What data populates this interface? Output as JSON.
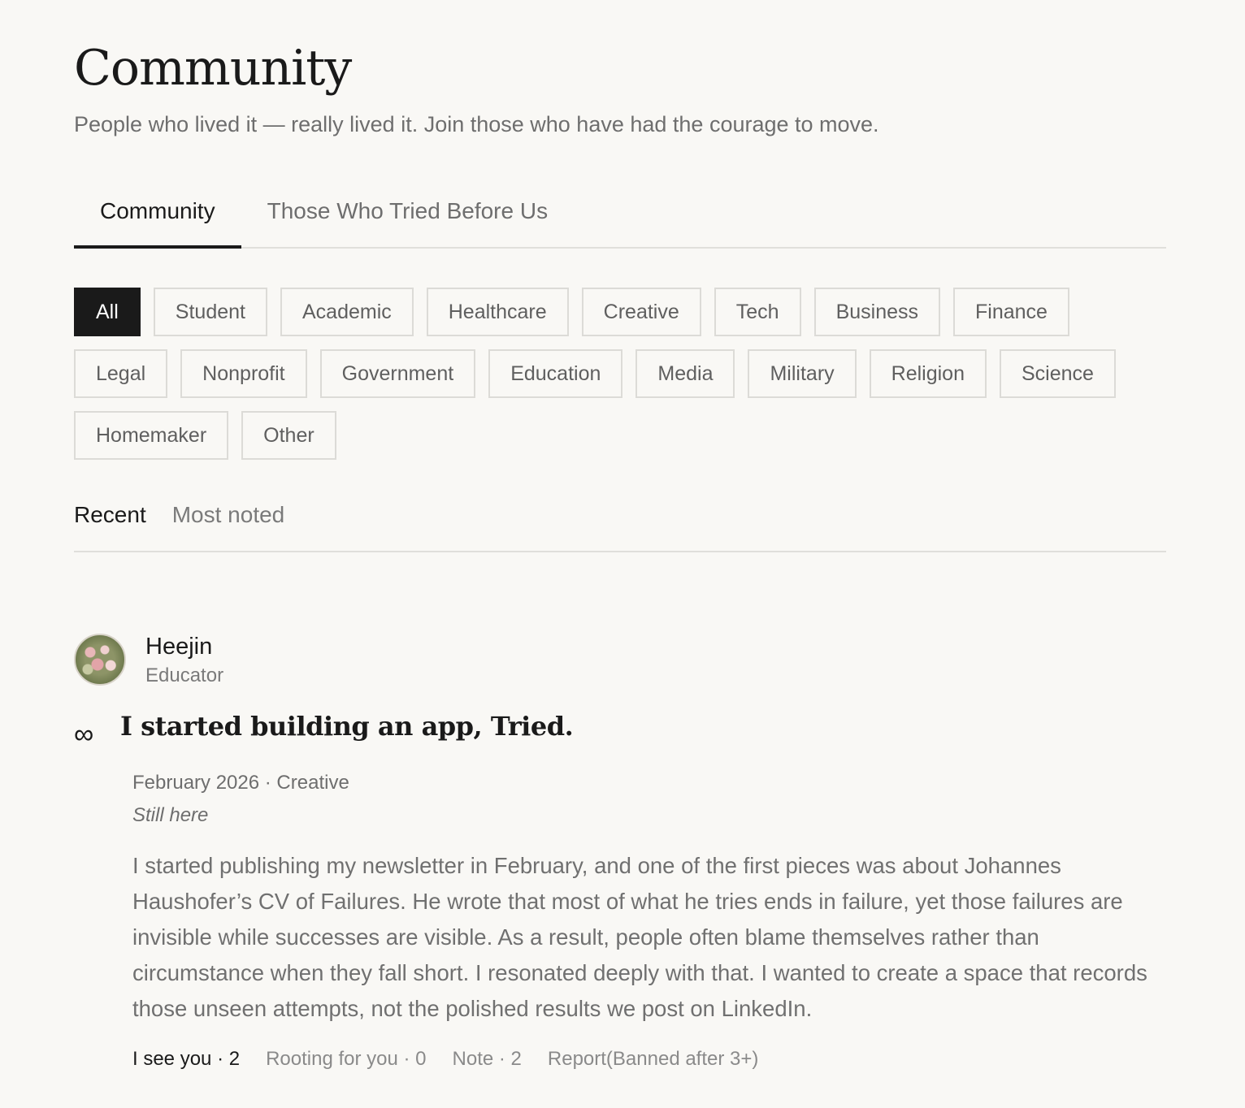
{
  "page": {
    "title": "Community",
    "subtitle": "People who lived it — really lived it. Join those who have had the courage to move."
  },
  "main_tabs": [
    {
      "label": "Community",
      "active": true
    },
    {
      "label": "Those Who Tried Before Us",
      "active": false
    }
  ],
  "categories": [
    {
      "label": "All",
      "active": true
    },
    {
      "label": "Student"
    },
    {
      "label": "Academic"
    },
    {
      "label": "Healthcare"
    },
    {
      "label": "Creative"
    },
    {
      "label": "Tech"
    },
    {
      "label": "Business"
    },
    {
      "label": "Finance"
    },
    {
      "label": "Legal"
    },
    {
      "label": "Nonprofit"
    },
    {
      "label": "Government"
    },
    {
      "label": "Education"
    },
    {
      "label": "Media"
    },
    {
      "label": "Military"
    },
    {
      "label": "Religion"
    },
    {
      "label": "Science"
    },
    {
      "label": "Homemaker"
    },
    {
      "label": "Other"
    }
  ],
  "sort_tabs": [
    {
      "label": "Recent",
      "active": true
    },
    {
      "label": "Most noted",
      "active": false
    }
  ],
  "post": {
    "author": {
      "name": "Heejin",
      "role": "Educator"
    },
    "icon": "∞",
    "title": "I started building an app, Tried.",
    "meta": "February 2026 · Creative",
    "status": "Still here",
    "body": "I started publishing my newsletter in February, and one of the first pieces was about Johannes Haushofer’s CV of Failures. He wrote that most of what he tries ends in failure, yet those failures are invisible while successes are visible. As a result, people often blame themselves rather than circumstance when they fall short. I resonated deeply with that. I wanted to create a space that records those unseen attempts, not the polished results we post on LinkedIn.",
    "actions": {
      "see_you": "I see you · 2",
      "rooting": "Rooting for you · 0",
      "note": "Note · 2",
      "report": "Report(Banned after 3+)"
    }
  },
  "colors": {
    "background": "#f9f8f5",
    "text": "#1a1a1a",
    "muted": "#6e6e6e",
    "border": "#dcdbd7",
    "active_chip": "#1a1a1a"
  }
}
